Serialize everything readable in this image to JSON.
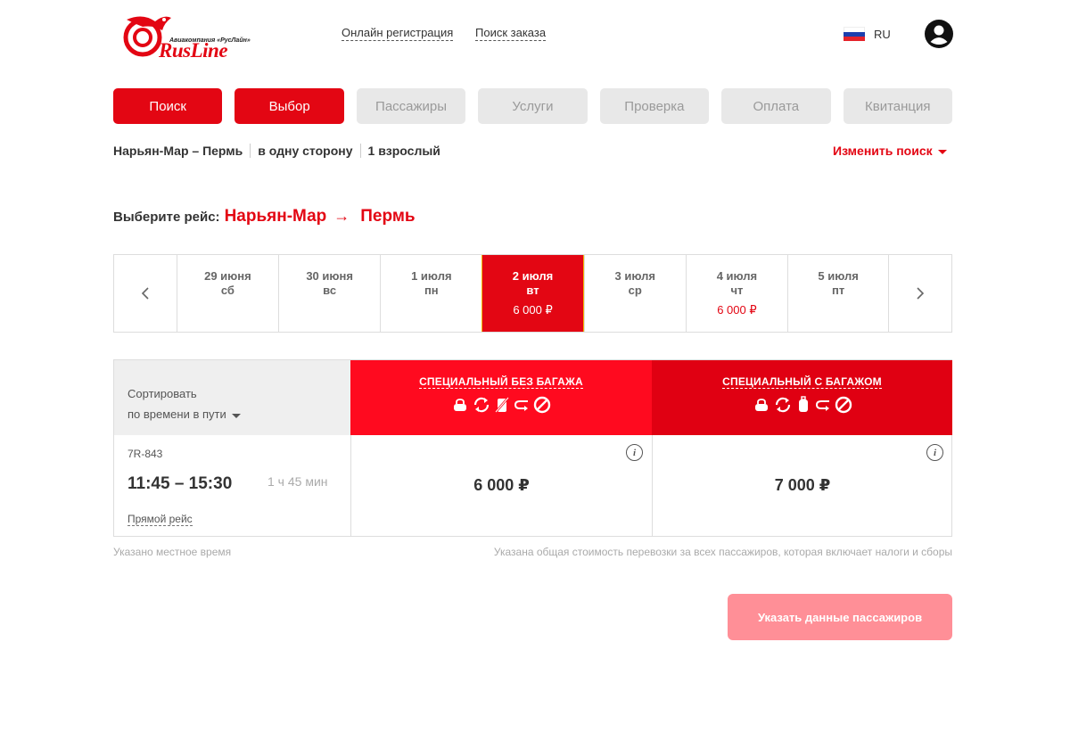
{
  "header": {
    "logo": {
      "subtitle": "Авиакомпания «РусЛайн»",
      "wordmark": "RusLine",
      "brand_color": "#e30613"
    },
    "links": [
      "Онлайн регистрация",
      "Поиск заказа"
    ],
    "language": {
      "code": "RU",
      "flag_icon": "russia-flag-icon"
    },
    "user_icon": "user-account-icon"
  },
  "steps": [
    {
      "label": "Поиск",
      "active": true
    },
    {
      "label": "Выбор",
      "active": true
    },
    {
      "label": "Пассажиры",
      "active": false
    },
    {
      "label": "Услуги",
      "active": false
    },
    {
      "label": "Проверка",
      "active": false
    },
    {
      "label": "Оплата",
      "active": false
    },
    {
      "label": "Квитанция",
      "active": false
    }
  ],
  "summary": {
    "route": "Нарьян-Мар – Пермь",
    "trip_type": "в одну сторону",
    "passengers": "1 взрослый",
    "change_label": "Изменить поиск"
  },
  "selection": {
    "label": "Выберите рейс:",
    "from": "Нарьян-Мар",
    "arrow": "→",
    "to": "Пермь"
  },
  "dates": [
    {
      "date": "29 июня",
      "weekday": "сб",
      "price": ""
    },
    {
      "date": "30 июня",
      "weekday": "вс",
      "price": ""
    },
    {
      "date": "1 июля",
      "weekday": "пн",
      "price": ""
    },
    {
      "date": "2 июля",
      "weekday": "вт",
      "price": "6 000 ₽",
      "selected": true
    },
    {
      "date": "3 июля",
      "weekday": "ср",
      "price": ""
    },
    {
      "date": "4 июля",
      "weekday": "чт",
      "price": "6 000 ₽"
    },
    {
      "date": "5 июля",
      "weekday": "пт",
      "price": ""
    }
  ],
  "fares": {
    "sort_label": "Сортировать",
    "sort_value": "по времени в пути",
    "columns": [
      {
        "title": "СПЕЦИАЛЬНЫЙ БЕЗ БАГАЖА",
        "color": "#ff0a1f",
        "icons": [
          "hand-bag-icon",
          "exchange-icon",
          "no-baggage-icon",
          "refund-icon",
          "prohibited-icon"
        ]
      },
      {
        "title": "СПЕЦИАЛЬНЫЙ С БАГАЖОМ",
        "color": "#e00012",
        "icons": [
          "hand-bag-icon",
          "exchange-icon",
          "baggage-icon",
          "refund-icon",
          "prohibited-icon"
        ]
      }
    ],
    "flight": {
      "number": "7R-843",
      "times": "11:45 – 15:30",
      "duration": "1 ч 45 мин",
      "type": "Прямой рейс",
      "prices": [
        "6 000 ₽",
        "7 000 ₽"
      ]
    }
  },
  "notes": {
    "left": "Указано местное время",
    "right": "Указана общая стоимость перевозки за всех пассажиров, которая включает налоги и сборы"
  },
  "continue_label": "Указать данные пассажиров"
}
